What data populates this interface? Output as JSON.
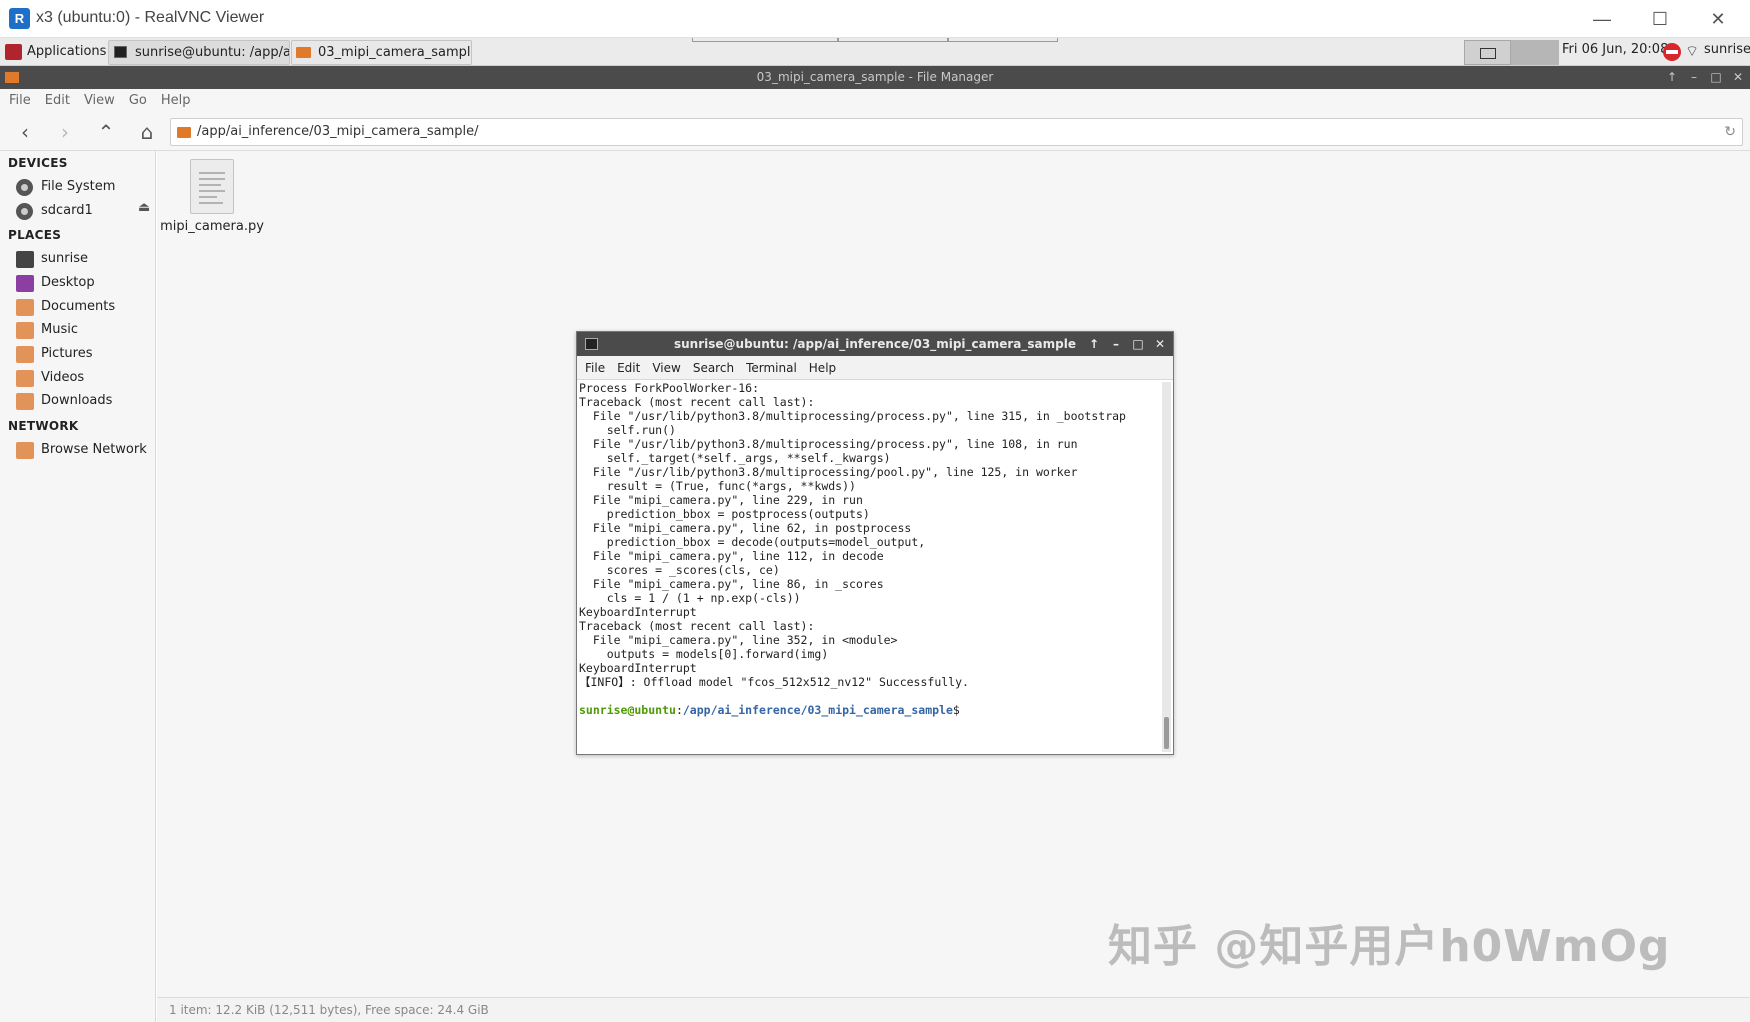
{
  "vnc": {
    "title": "x3 (ubuntu:0) - RealVNC Viewer",
    "logo_label": "R",
    "minimize": "—",
    "maximize": "☐",
    "close": "✕"
  },
  "panel": {
    "applications": "Applications",
    "separator": "⁞",
    "tasks": [
      {
        "label": "sunrise@ubuntu: /app/a..."
      },
      {
        "label": "03_mipi_camera_sampl..."
      }
    ],
    "clock": "Fri 06 Jun, 20:08",
    "user": "sunrise"
  },
  "file_manager": {
    "title": "03_mipi_camera_sample - File Manager",
    "menu": [
      "File",
      "Edit",
      "View",
      "Go",
      "Help"
    ],
    "path": "/app/ai_inference/03_mipi_camera_sample/",
    "sidebar": {
      "devices_header": "DEVICES",
      "devices": [
        "File System",
        "sdcard1"
      ],
      "places_header": "PLACES",
      "places": [
        "sunrise",
        "Desktop",
        "Documents",
        "Music",
        "Pictures",
        "Videos",
        "Downloads"
      ],
      "network_header": "NETWORK",
      "network": [
        "Browse Network"
      ]
    },
    "files": [
      {
        "name": "mipi_camera.py"
      }
    ],
    "status": "1 item: 12.2 KiB (12,511 bytes), Free space: 24.4 GiB"
  },
  "terminal": {
    "title": "sunrise@ubuntu: /app/ai_inference/03_mipi_camera_sample",
    "menu": [
      "File",
      "Edit",
      "View",
      "Search",
      "Terminal",
      "Help"
    ],
    "lines": [
      "Process ForkPoolWorker-16:",
      "Traceback (most recent call last):",
      "  File \"/usr/lib/python3.8/multiprocessing/process.py\", line 315, in _bootstrap",
      "    self.run()",
      "  File \"/usr/lib/python3.8/multiprocessing/process.py\", line 108, in run",
      "    self._target(*self._args, **self._kwargs)",
      "  File \"/usr/lib/python3.8/multiprocessing/pool.py\", line 125, in worker",
      "    result = (True, func(*args, **kwds))",
      "  File \"mipi_camera.py\", line 229, in run",
      "    prediction_bbox = postprocess(outputs)",
      "  File \"mipi_camera.py\", line 62, in postprocess",
      "    prediction_bbox = decode(outputs=model_output,",
      "  File \"mipi_camera.py\", line 112, in decode",
      "    scores = _scores(cls, ce)",
      "  File \"mipi_camera.py\", line 86, in _scores",
      "    cls = 1 / (1 + np.exp(-cls))",
      "KeyboardInterrupt",
      "Traceback (most recent call last):",
      "  File \"mipi_camera.py\", line 352, in <module>",
      "    outputs = models[0].forward(img)",
      "KeyboardInterrupt",
      "【INFO】: Offload model \"fcos_512x512_nv12\" Successfully.",
      ""
    ],
    "prompt_user": "sunrise@ubuntu",
    "prompt_sep": ":",
    "prompt_path": "/app/ai_inference/03_mipi_camera_sample",
    "prompt_end": "$"
  },
  "watermark": "知乎 @知乎用户h0WmOg",
  "colors": {
    "titlebar_dark": "#4b4b4b",
    "folder_orange": "#e0792a",
    "prompt_green": "#4e9a06",
    "prompt_blue": "#3465a4"
  }
}
